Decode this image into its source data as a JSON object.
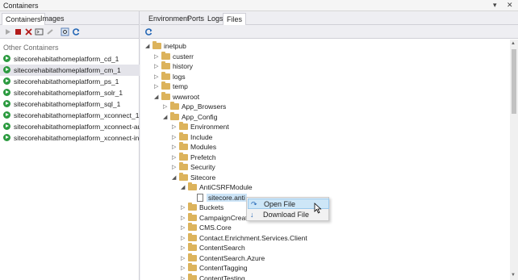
{
  "window": {
    "title": "Containers",
    "pin_icon": "pin-icon",
    "close_icon": "close-icon"
  },
  "left_panel": {
    "tabs": [
      "Containers",
      "Images"
    ],
    "section_title": "Other Containers",
    "containers": [
      "sitecorehabitathomeplatform_cd_1",
      "sitecorehabitathomeplatform_cm_1",
      "sitecorehabitathomeplatform_ps_1",
      "sitecorehabitathomeplatform_solr_1",
      "sitecorehabitathomeplatform_sql_1",
      "sitecorehabitathomeplatform_xconnect_1",
      "sitecorehabitathomeplatform_xconnect-automa",
      "sitecorehabitathomeplatform_xconnect-indexw"
    ],
    "selected_index": 1
  },
  "right_panel": {
    "tabs": [
      "Environment",
      "Ports",
      "Logs",
      "Files"
    ],
    "active_tab": "Files",
    "tree": [
      {
        "label": "inetpub",
        "depth": 0,
        "expanded": true,
        "type": "folder"
      },
      {
        "label": "custerr",
        "depth": 1,
        "expanded": false,
        "type": "folder"
      },
      {
        "label": "history",
        "depth": 1,
        "expanded": false,
        "type": "folder"
      },
      {
        "label": "logs",
        "depth": 1,
        "expanded": false,
        "type": "folder"
      },
      {
        "label": "temp",
        "depth": 1,
        "expanded": false,
        "type": "folder"
      },
      {
        "label": "wwwroot",
        "depth": 1,
        "expanded": true,
        "type": "folder"
      },
      {
        "label": "App_Browsers",
        "depth": 2,
        "expanded": false,
        "type": "folder"
      },
      {
        "label": "App_Config",
        "depth": 2,
        "expanded": true,
        "type": "folder"
      },
      {
        "label": "Environment",
        "depth": 3,
        "expanded": false,
        "type": "folder"
      },
      {
        "label": "Include",
        "depth": 3,
        "expanded": false,
        "type": "folder"
      },
      {
        "label": "Modules",
        "depth": 3,
        "expanded": false,
        "type": "folder"
      },
      {
        "label": "Prefetch",
        "depth": 3,
        "expanded": false,
        "type": "folder"
      },
      {
        "label": "Security",
        "depth": 3,
        "expanded": false,
        "type": "folder"
      },
      {
        "label": "Sitecore",
        "depth": 3,
        "expanded": true,
        "type": "folder"
      },
      {
        "label": "AntiCSRFModule",
        "depth": 4,
        "expanded": true,
        "type": "folder"
      },
      {
        "label": "sitecore.anti",
        "depth": 5,
        "expanded": null,
        "type": "file",
        "highlight": true
      },
      {
        "label": "Buckets",
        "depth": 4,
        "expanded": false,
        "type": "folder"
      },
      {
        "label": "CampaignCreat",
        "depth": 4,
        "expanded": false,
        "type": "folder"
      },
      {
        "label": "CMS.Core",
        "depth": 4,
        "expanded": false,
        "type": "folder"
      },
      {
        "label": "Contact.Enrichment.Services.Client",
        "depth": 4,
        "expanded": false,
        "type": "folder"
      },
      {
        "label": "ContentSearch",
        "depth": 4,
        "expanded": false,
        "type": "folder"
      },
      {
        "label": "ContentSearch.Azure",
        "depth": 4,
        "expanded": false,
        "type": "folder"
      },
      {
        "label": "ContentTagging",
        "depth": 4,
        "expanded": false,
        "type": "folder"
      },
      {
        "label": "ContentTesting",
        "depth": 4,
        "expanded": false,
        "type": "folder"
      }
    ]
  },
  "context_menu": {
    "items": [
      {
        "label": "Open File",
        "icon": "open-file-icon"
      },
      {
        "label": "Download File",
        "icon": "download-icon"
      }
    ],
    "hover_index": 0
  }
}
